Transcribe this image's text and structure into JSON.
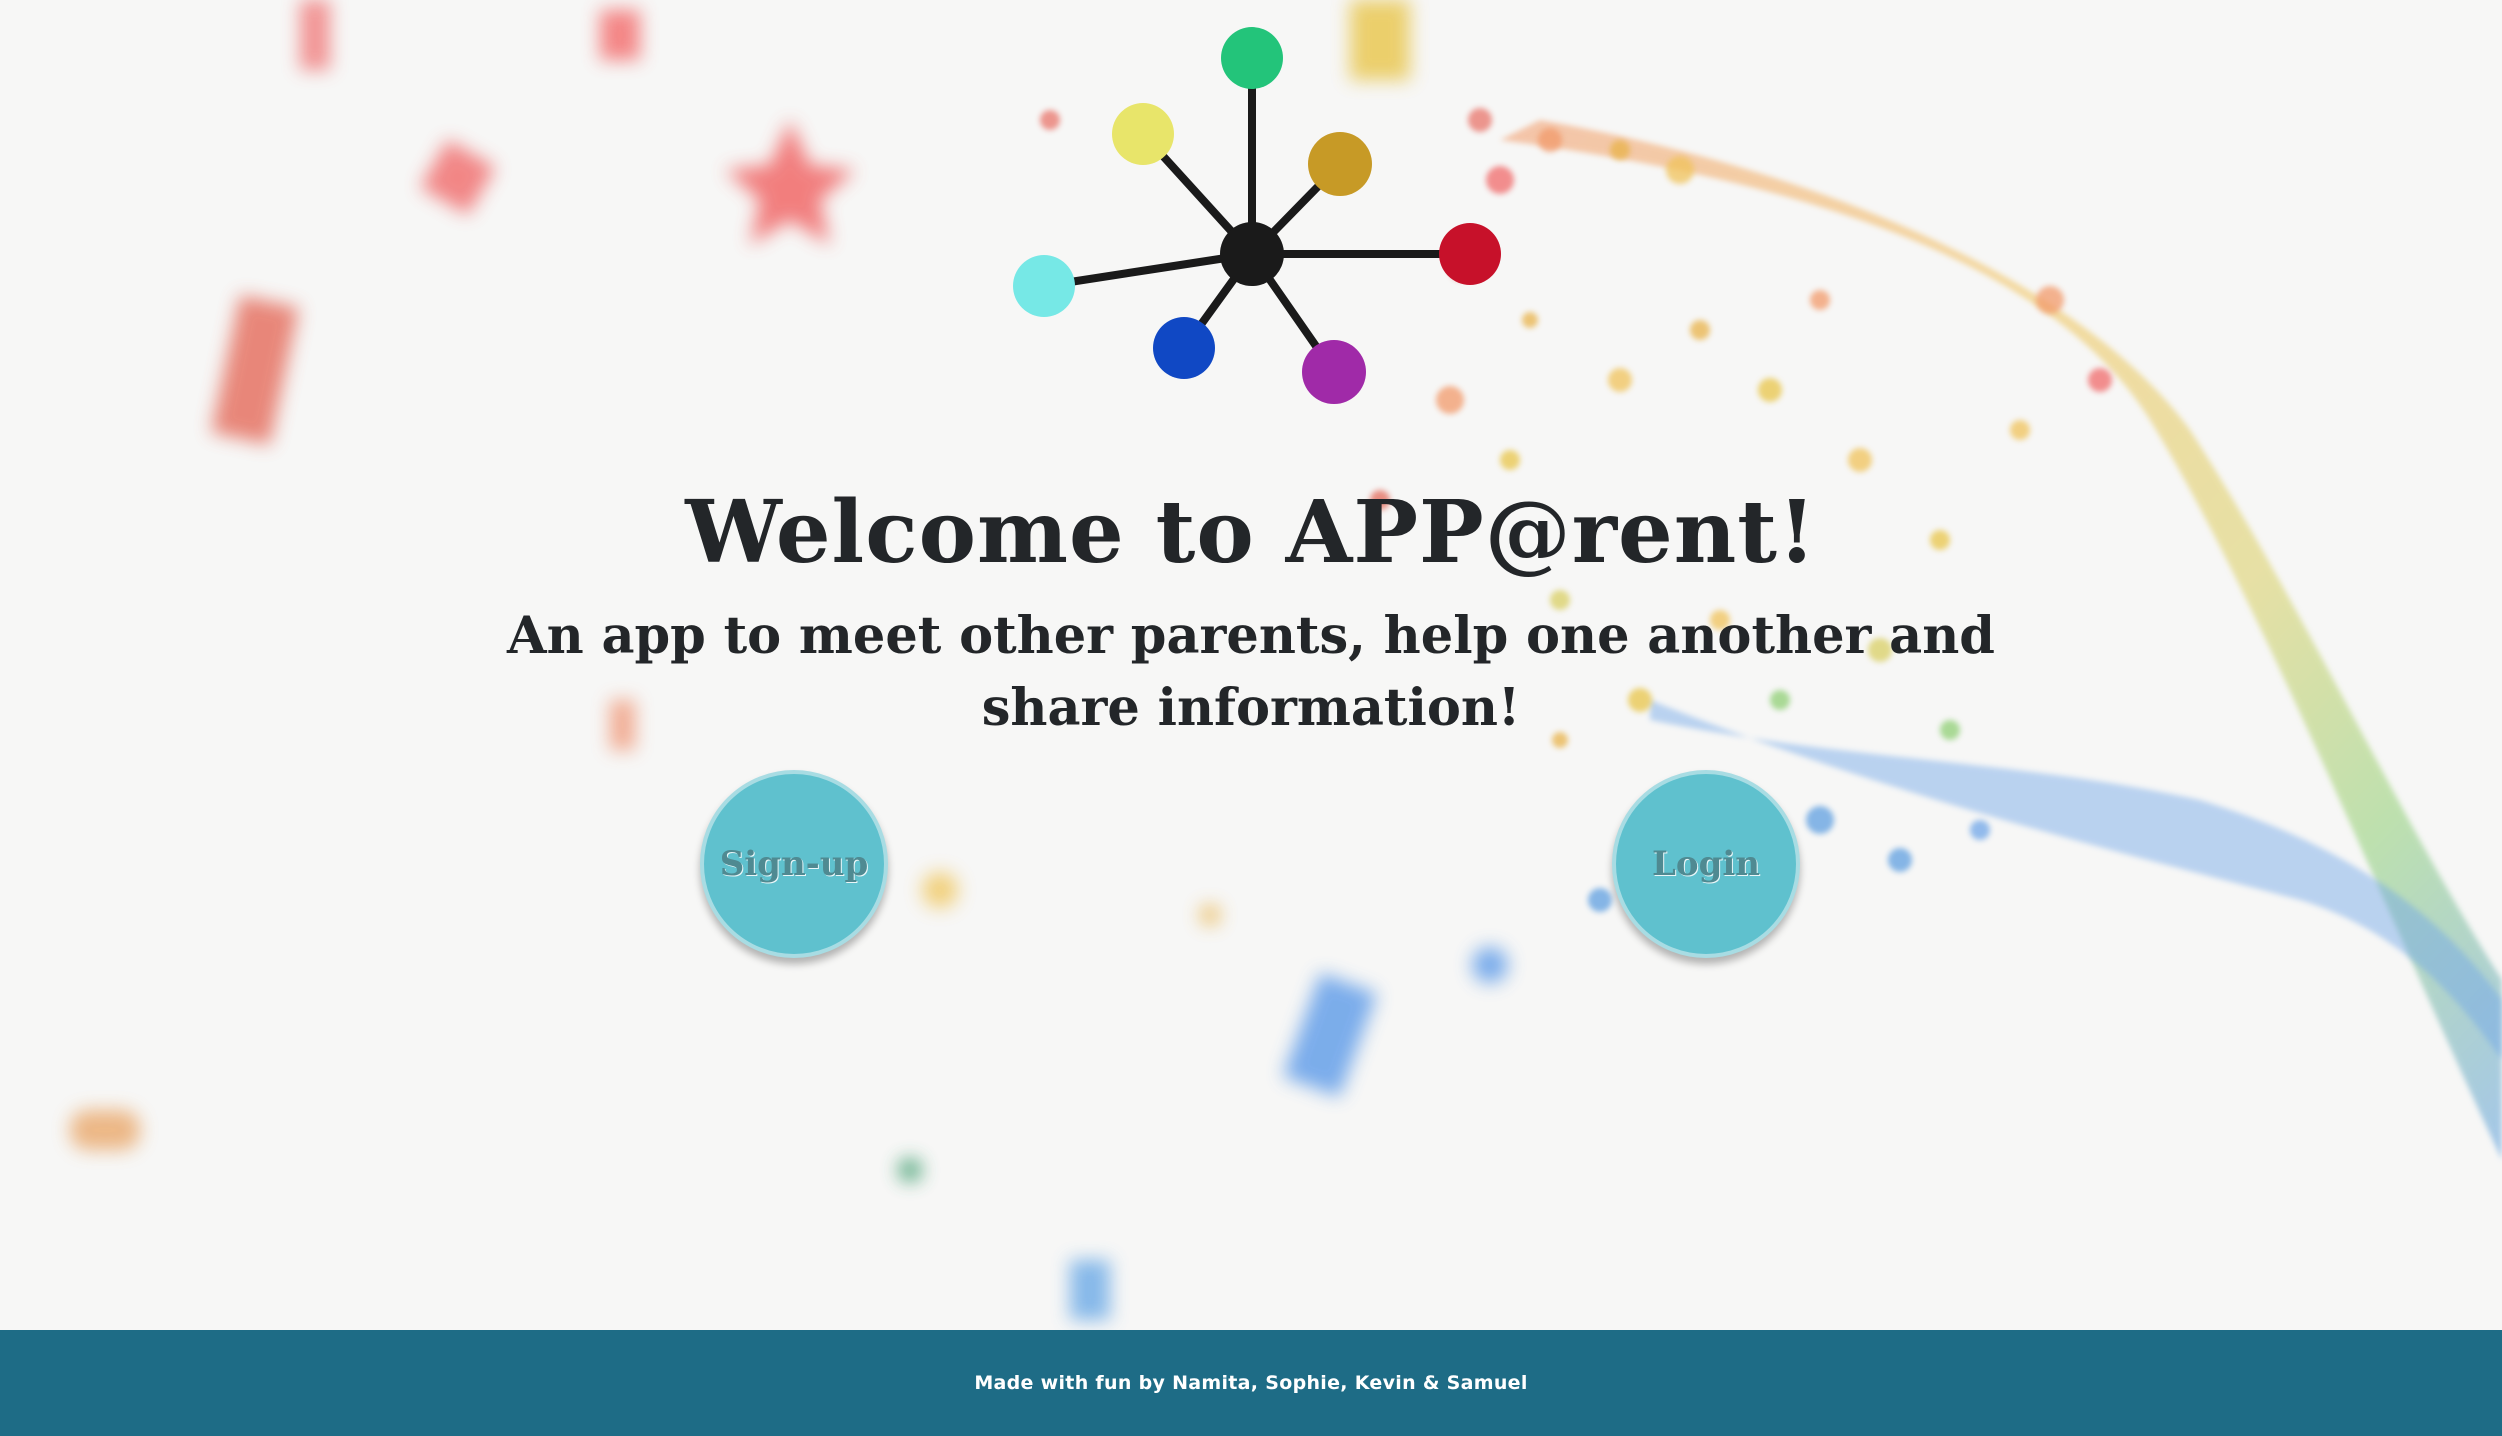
{
  "hero": {
    "title": "Welcome to APP@rent!",
    "subtitle": "An app to meet other parents, help one another and share information!"
  },
  "actions": {
    "signup_label": "Sign-up",
    "login_label": "Login"
  },
  "footer": {
    "credit": "Made with fun by Namita, Sophie, Kevin & Samuel"
  },
  "logo": {
    "hub_color": "#1a1a1a",
    "node_colors": [
      "#23c47a",
      "#e8e56a",
      "#c79a26",
      "#c7112a",
      "#76e8e6",
      "#1048c4",
      "#a02aa8"
    ]
  },
  "theme": {
    "button_color": "#5fc1ce",
    "footer_color": "#1e6c86"
  }
}
